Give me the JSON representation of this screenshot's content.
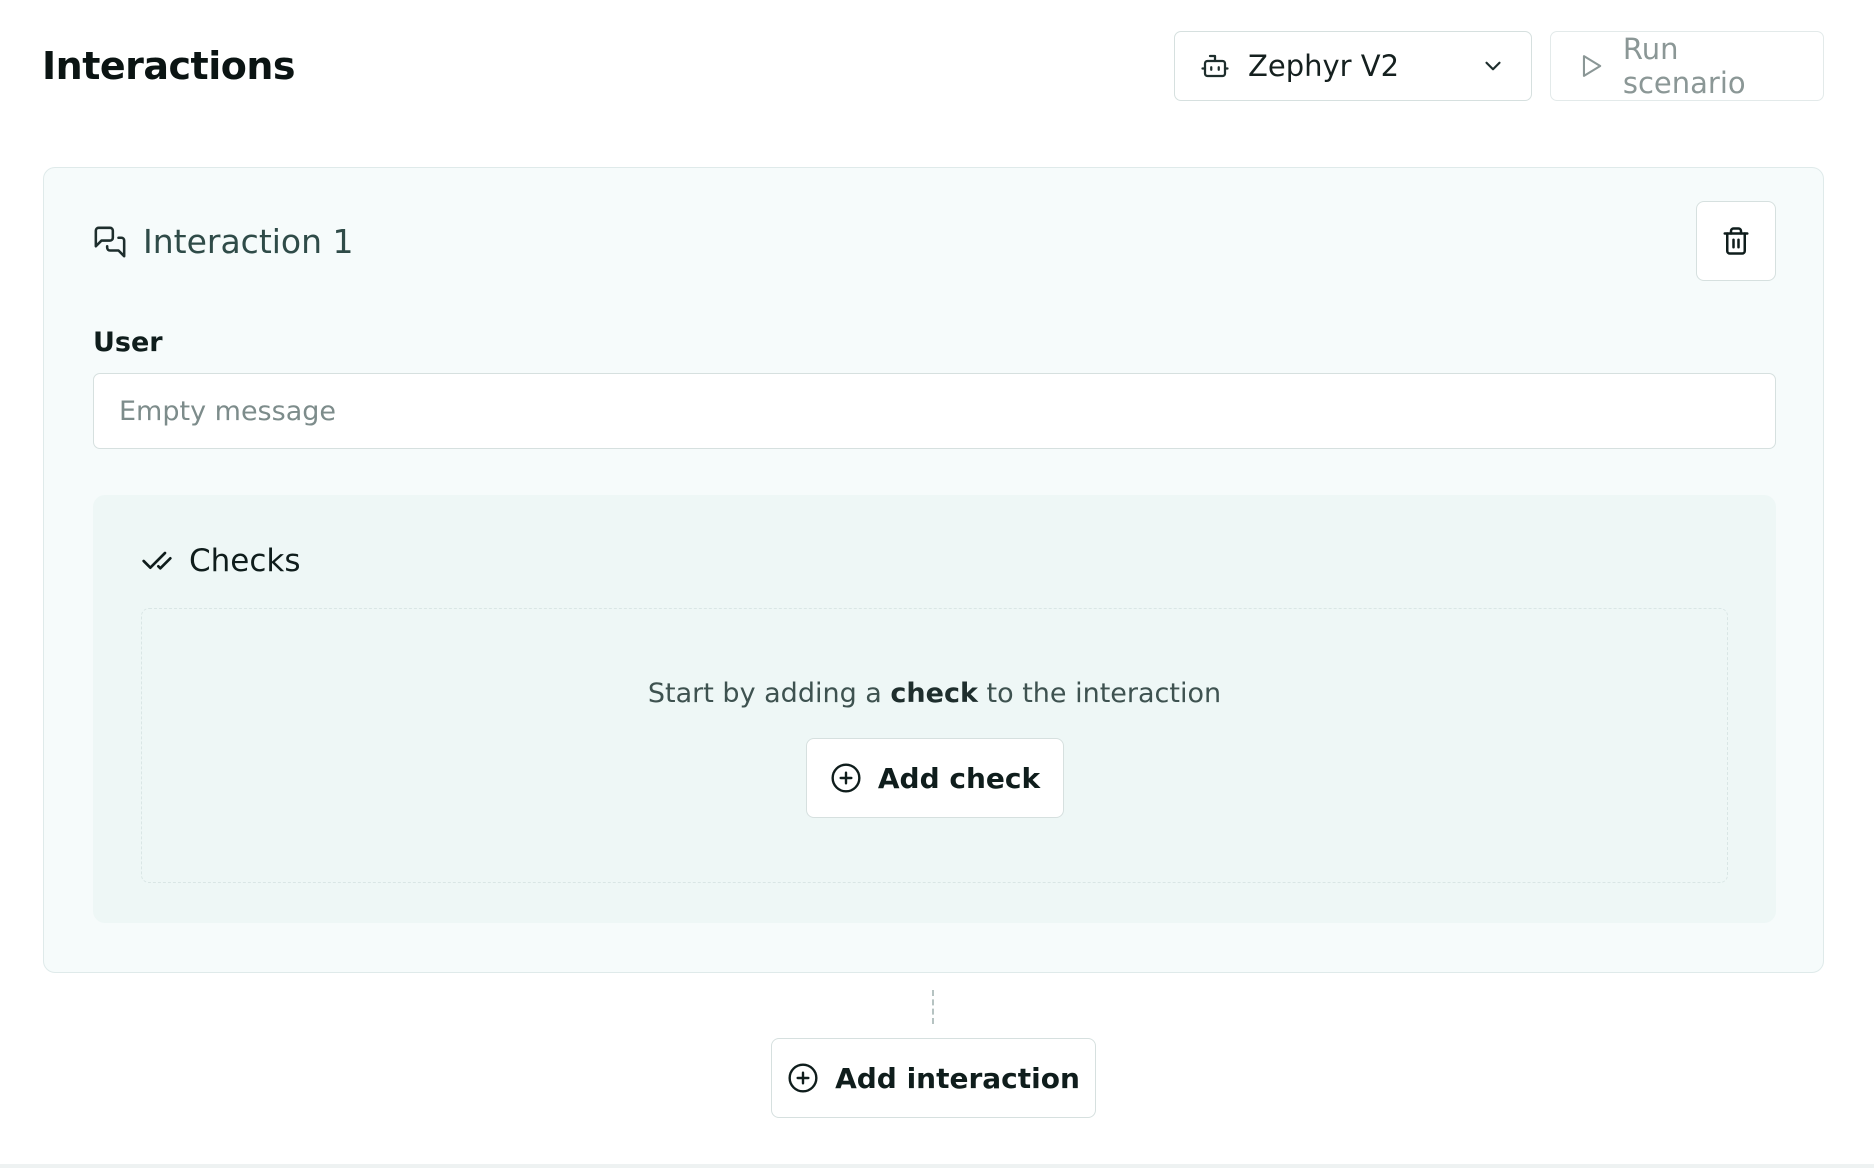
{
  "header": {
    "title": "Interactions",
    "model_select": {
      "value": "Zephyr V2",
      "icon": "bot-icon"
    },
    "run_button": {
      "label": "Run scenario",
      "icon": "play-icon",
      "disabled": true
    }
  },
  "interaction": {
    "title": "Interaction 1",
    "icon": "messages-icon",
    "delete_icon": "trash-icon",
    "user_field": {
      "label": "User",
      "value": "",
      "placeholder": "Empty message"
    },
    "checks": {
      "title": "Checks",
      "icon": "check-check-icon",
      "empty_text_before": "Start by adding a ",
      "empty_text_bold": "check",
      "empty_text_after": " to the interaction",
      "add_button": "Add check"
    }
  },
  "add_interaction_button": "Add interaction",
  "colors": {
    "card_bg": "#f6fbfb",
    "panel_bg": "#eef7f6",
    "border": "#d6e0df",
    "muted_text": "#8b9796",
    "title_text": "#2f4b48"
  }
}
